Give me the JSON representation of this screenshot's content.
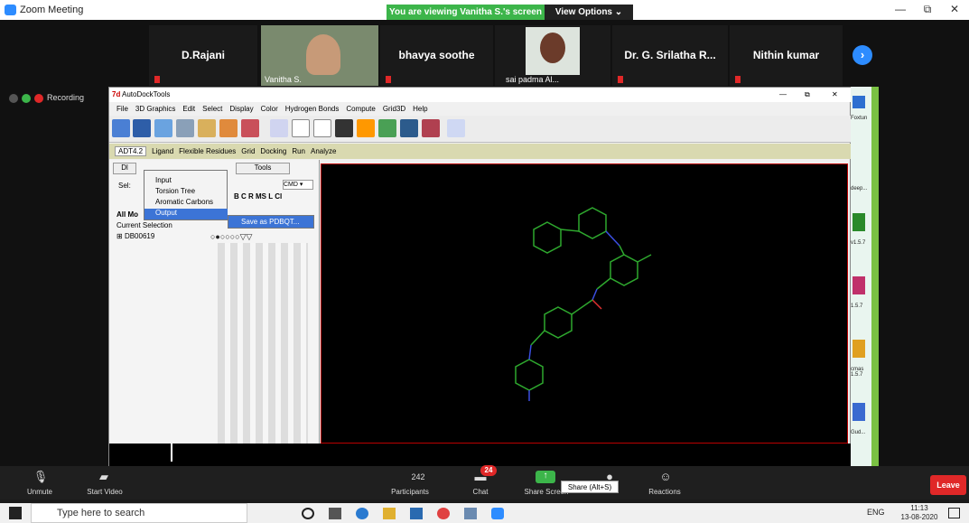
{
  "window": {
    "title": "Zoom Meeting",
    "min": "—",
    "max": "⧉",
    "close": "✕"
  },
  "banner": {
    "viewing": "You are viewing Vanitha S.'s screen",
    "view_options": "View Options ⌄"
  },
  "participants": [
    {
      "name": "D.Rajani"
    },
    {
      "name": "",
      "caption": "Vanitha S."
    },
    {
      "name": "bhavya soothe"
    },
    {
      "name": "",
      "caption": "sai padma Al..."
    },
    {
      "name": "Dr. G. Srilatha R..."
    },
    {
      "name": "Nithin kumar"
    }
  ],
  "recording": "Recording",
  "adt": {
    "title": "AutoDockTools",
    "menu": [
      "File",
      "3D Graphics",
      "Edit",
      "Select",
      "Display",
      "Color",
      "Hydrogen Bonds",
      "Compute",
      "Grid3D",
      "Help"
    ],
    "tabs": [
      "ADT4.2",
      "Ligand",
      "Flexible Residues",
      "Grid",
      "Docking",
      "Run",
      "Analyze"
    ],
    "panel": {
      "tab_tools": "Tools",
      "sel_label": "Sel:",
      "cmd": "CMD ▾",
      "atoms": "B C R MS L Cl",
      "all_mol": "All Mo",
      "current_sel": "Current Selection",
      "molecule": "DB00619",
      "dots": "○●○○○○▽▽",
      "dl": "Dl"
    },
    "context_menu": [
      "Input",
      "Torsion Tree",
      "Aromatic Carbons",
      "Output"
    ],
    "submenu": "Save as PDBQT..."
  },
  "side": [
    "Foxtun",
    "deep...",
    "v1.5.7",
    "1.5.7",
    "cmas 1.5.7",
    "Gud..."
  ],
  "bottombar": {
    "unmute": "Unmute",
    "start_video": "Start Video",
    "participants": "Participants",
    "participants_count": "242",
    "chat": "Chat",
    "chat_badge": "24",
    "share_screen": "Share Screen",
    "share_tooltip": "Share (Alt+S)",
    "record": "Record",
    "reactions": "Reactions",
    "leave": "Leave"
  },
  "taskbar": {
    "search_placeholder": "Type here to search",
    "lang": "ENG",
    "time": "11:13",
    "date": "13-08-2020"
  }
}
